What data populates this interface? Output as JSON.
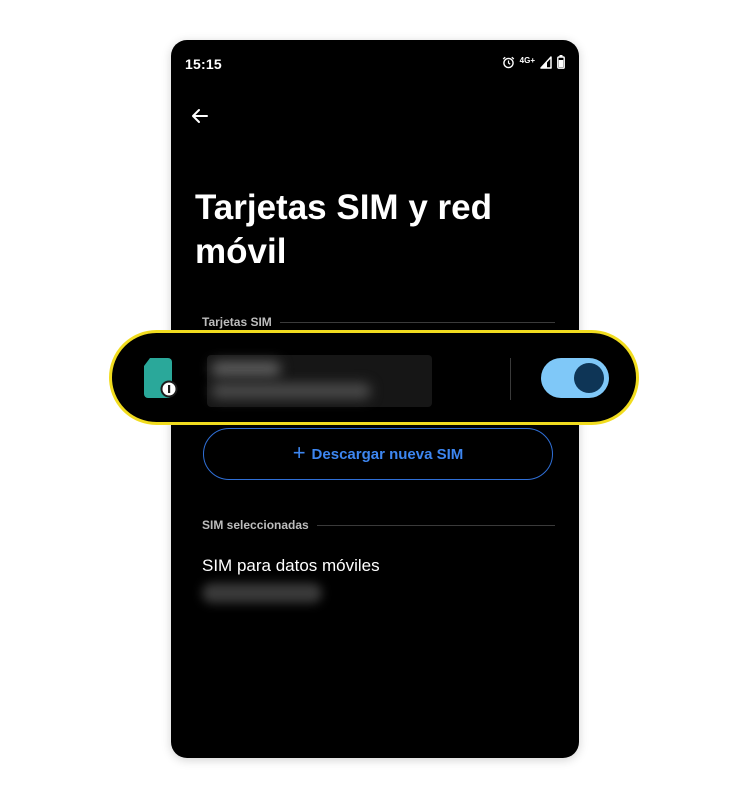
{
  "status_bar": {
    "time": "15:15",
    "network": "4G+",
    "icons": [
      "alarm-icon",
      "signal-icon",
      "battery-icon"
    ]
  },
  "header": {
    "back_icon": "arrow-left-icon",
    "title": "Tarjetas SIM y red móvil"
  },
  "sim_section": {
    "header": "Tarjetas SIM",
    "sim_card": {
      "icon": "sim-card-icon",
      "slot_badge": "1",
      "enabled": true
    },
    "download_button": {
      "icon": "plus",
      "label": "Descargar nueva SIM"
    }
  },
  "selected_section": {
    "header": "SIM seleccionadas",
    "data_sim": {
      "title": "SIM para datos móviles"
    }
  },
  "colors": {
    "background": "#000000",
    "highlight_border": "#f1dc1f",
    "toggle_track": "#7fc8f8",
    "toggle_knob": "#0e3556",
    "accent_blue": "#3d86f0",
    "sim_icon_teal": "#2aa89a"
  }
}
